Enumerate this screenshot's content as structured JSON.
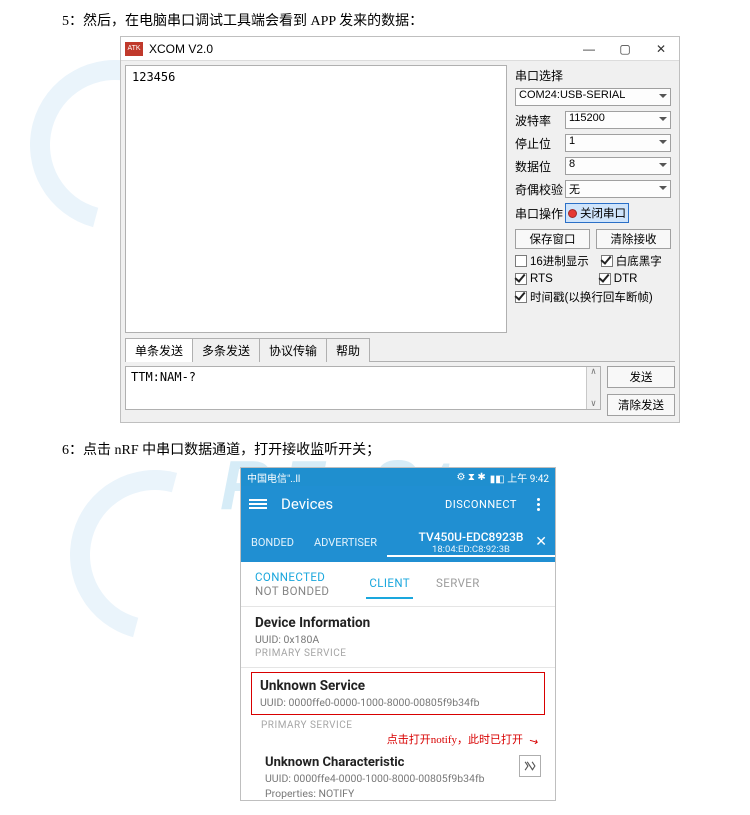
{
  "step5_caption": "5：然后，在电脑串口调试工具端会看到 APP 发来的数据：",
  "step6_caption": "6：点击 nRF 中串口数据通道，打开接收监听开关；",
  "xcom": {
    "app_icon_text": "ATK",
    "title": "XCOM V2.0",
    "win": {
      "min": "—",
      "max": "▢",
      "close": "✕"
    },
    "rx_text": "123456",
    "group": {
      "title": "串口选择",
      "port_value": "COM24:USB-SERIAL",
      "rows": {
        "baud_label": "波特率",
        "baud_value": "115200",
        "stop_label": "停止位",
        "stop_value": "1",
        "data_label": "数据位",
        "data_value": "8",
        "parity_label": "奇偶校验",
        "parity_value": "无",
        "op_label": "串口操作",
        "op_btn": "关闭串口"
      },
      "buttons": {
        "save": "保存窗口",
        "clear": "清除接收"
      },
      "checks": {
        "hex_display": "16进制显示",
        "white_bg": "白底黑字",
        "rts": "RTS",
        "dtr": "DTR",
        "timestamp": "时间戳(以换行回车断帧)"
      }
    },
    "tabs": {
      "single": "单条发送",
      "multi": "多条发送",
      "protocol": "协议传输",
      "help": "帮助"
    },
    "tx_text": "TTM:NAM-?",
    "send_btn": "发送",
    "clear_send_btn": "清除发送"
  },
  "phone": {
    "status": {
      "carrier": "中国电信\"..ll",
      "icons": "⚙ ⧗ ✱",
      "batt_time": "▮◧ 上午 9:42"
    },
    "appbar": {
      "title": "Devices",
      "disconnect": "DISCONNECT"
    },
    "tabbar": {
      "bonded": "BONDED",
      "advertiser": "ADVERTISER",
      "dev_name": "TV450U-EDC8923B",
      "dev_mac": "18:04:ED:C8:92:3B"
    },
    "conn": {
      "line1": "CONNECTED",
      "line2": "NOT BONDED"
    },
    "inner_tabs": {
      "client": "CLIENT",
      "server": "SERVER"
    },
    "svc1": {
      "name": "Device Information",
      "uuid_label": "UUID:",
      "uuid": "0x180A",
      "meta": "PRIMARY SERVICE"
    },
    "svc2": {
      "name": "Unknown Service",
      "uuid_label": "UUID:",
      "uuid": "0000ffe0-0000-1000-8000-00805f9b34fb",
      "meta": "PRIMARY SERVICE"
    },
    "annotation": "点击打开notify，此时已打开",
    "char": {
      "name": "Unknown Characteristic",
      "uuid_label": "UUID:",
      "uuid": "0000ffe4-0000-1000-8000-00805f9b34fb",
      "meta_label": "Properties:",
      "meta": "NOTIFY"
    }
  }
}
